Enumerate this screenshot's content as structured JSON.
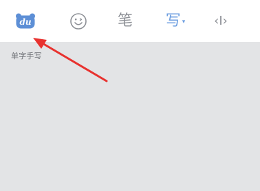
{
  "toolbar": {
    "items": [
      {
        "icon": "baidu-paw-logo-icon",
        "text": "du"
      },
      {
        "icon": "smiley-face-icon"
      },
      {
        "icon": "pen-icon",
        "label": "笔"
      },
      {
        "icon": "handwrite-icon",
        "label": "写",
        "caret": "▾",
        "active": true
      },
      {
        "icon": "cursor-move-icon",
        "label": "‹I›"
      }
    ]
  },
  "panel": {
    "mode_label": "单字手写"
  },
  "annotation": {
    "type": "arrow",
    "color": "#e8322f",
    "points_to": "toolbar.items.0"
  },
  "colors": {
    "toolbar_bg": "#ffffff",
    "panel_bg": "#e3e4e6",
    "icon_gray": "#8d9096",
    "active_blue": "#6d9ee0",
    "logo_blue": "#5d8fd6",
    "arrow_red": "#e8322f"
  }
}
